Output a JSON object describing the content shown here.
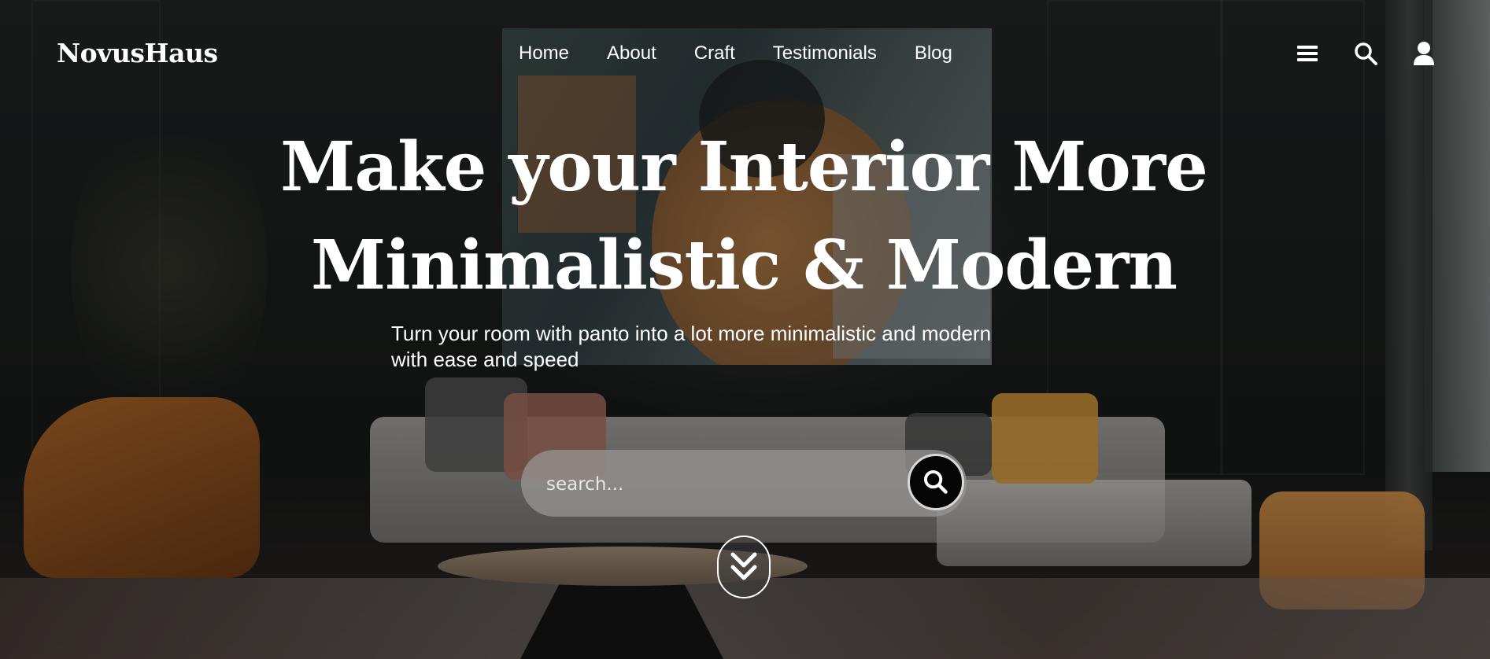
{
  "brand": {
    "logo": "NovusHaus"
  },
  "nav": {
    "items": [
      "Home",
      "About",
      "Craft",
      "Testimonials",
      "Blog"
    ]
  },
  "header_icons": [
    "menu-icon",
    "search-icon",
    "user-icon"
  ],
  "hero": {
    "title_line1": "Make your Interior More",
    "title_line2": "Minimalistic & Modern",
    "subtitle_line1": "Turn your room with panto into a lot more minimalistic and modern",
    "subtitle_line2": "with ease and speed"
  },
  "search": {
    "placeholder": "search...",
    "value": ""
  },
  "scroll_icon": "double-chevron-down-icon",
  "colors": {
    "text": "#ffffff",
    "search_button": "#050505",
    "search_bar": "#969492"
  }
}
